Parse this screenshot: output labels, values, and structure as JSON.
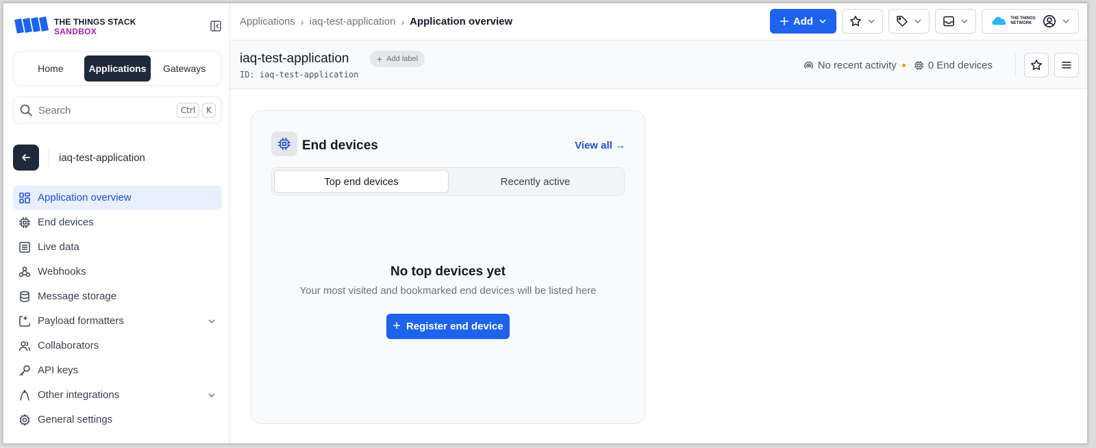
{
  "brand": {
    "line1": "THE THINGS STACK",
    "line2": "SANDBOX",
    "accent_color": "#a21caf",
    "logo_blue": "#1d63ed",
    "network_logo_text1": "THE THINGS",
    "network_logo_text2": "NETWORK"
  },
  "nav": {
    "tabs": [
      {
        "label": "Home"
      },
      {
        "label": "Applications"
      },
      {
        "label": "Gateways"
      }
    ],
    "active_tab": "Applications"
  },
  "search": {
    "placeholder": "Search",
    "shortcut_key1": "Ctrl",
    "shortcut_key2": "K"
  },
  "context": {
    "name": "iaq-test-application"
  },
  "menu": {
    "items": [
      {
        "label": "Application overview",
        "icon": "grid-icon"
      },
      {
        "label": "End devices",
        "icon": "chip-icon"
      },
      {
        "label": "Live data",
        "icon": "list-icon"
      },
      {
        "label": "Webhooks",
        "icon": "webhook-icon"
      },
      {
        "label": "Message storage",
        "icon": "database-icon"
      },
      {
        "label": "Payload formatters",
        "icon": "code-icon"
      },
      {
        "label": "Collaborators",
        "icon": "users-icon"
      },
      {
        "label": "API keys",
        "icon": "key-icon"
      },
      {
        "label": "Other integrations",
        "icon": "integration-icon"
      },
      {
        "label": "General settings",
        "icon": "gear-icon"
      }
    ]
  },
  "breadcrumb": {
    "items": [
      "Applications",
      "iaq-test-application"
    ],
    "current": "Application overview"
  },
  "toolbar": {
    "add_label": "Add"
  },
  "app_header": {
    "title": "iaq-test-application",
    "id_text": "ID: iaq-test-application",
    "add_label": "Add label",
    "activity": "No recent activity",
    "device_count": "0 End devices"
  },
  "card": {
    "title": "End devices",
    "view_all": "View all →",
    "tabs": [
      {
        "label": "Top end devices"
      },
      {
        "label": "Recently active"
      }
    ],
    "empty_title": "No top devices yet",
    "empty_subtitle": "Your most visited and bookmarked end devices will be listed here",
    "register_button": "Register end device"
  },
  "colors": {
    "primary": "#1d63ed",
    "dark": "#1e293b",
    "active_bg": "#e8efff",
    "activity_dot": "#f59e0b"
  }
}
